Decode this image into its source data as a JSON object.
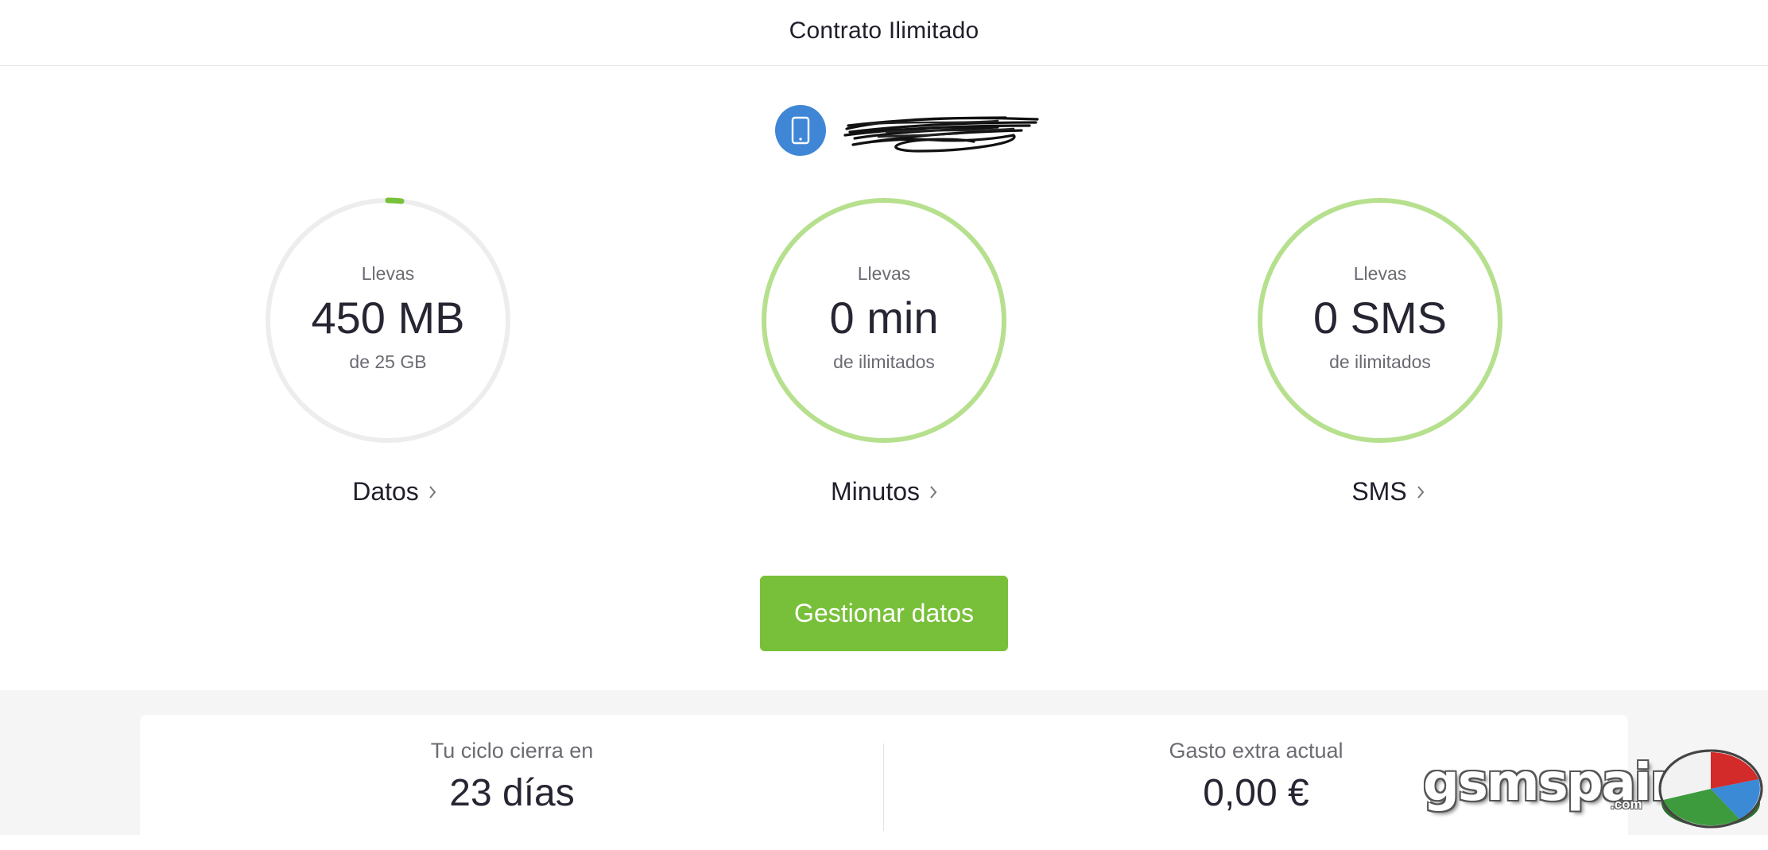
{
  "header": {
    "title": "Contrato Ilimitado"
  },
  "line": {
    "icon": "mobile-phone-icon",
    "badge_color": "#3f86d6"
  },
  "meters": [
    {
      "caption": "Llevas",
      "value": "450 MB",
      "limit": "de 25 GB",
      "link": "Datos",
      "usage_fraction": 0.018,
      "ring_color": "#ededed",
      "fill_color": "#78c03a"
    },
    {
      "caption": "Llevas",
      "value": "0 min",
      "limit": "de ilimitados",
      "link": "Minutos",
      "usage_fraction": 1,
      "ring_color": "#b6e08e"
    },
    {
      "caption": "Llevas",
      "value": "0 SMS",
      "limit": "de ilimitados",
      "link": "SMS",
      "usage_fraction": 1,
      "ring_color": "#b6e08e"
    }
  ],
  "manage_button": {
    "label": "Gestionar datos",
    "color": "#78c03a"
  },
  "summary": {
    "cycle": {
      "label": "Tu ciclo cierra en",
      "value": "23 días"
    },
    "extra": {
      "label": "Gasto extra actual",
      "value": "0,00 €"
    }
  },
  "watermark": {
    "text": "gsmspain",
    "sub": ".com"
  }
}
